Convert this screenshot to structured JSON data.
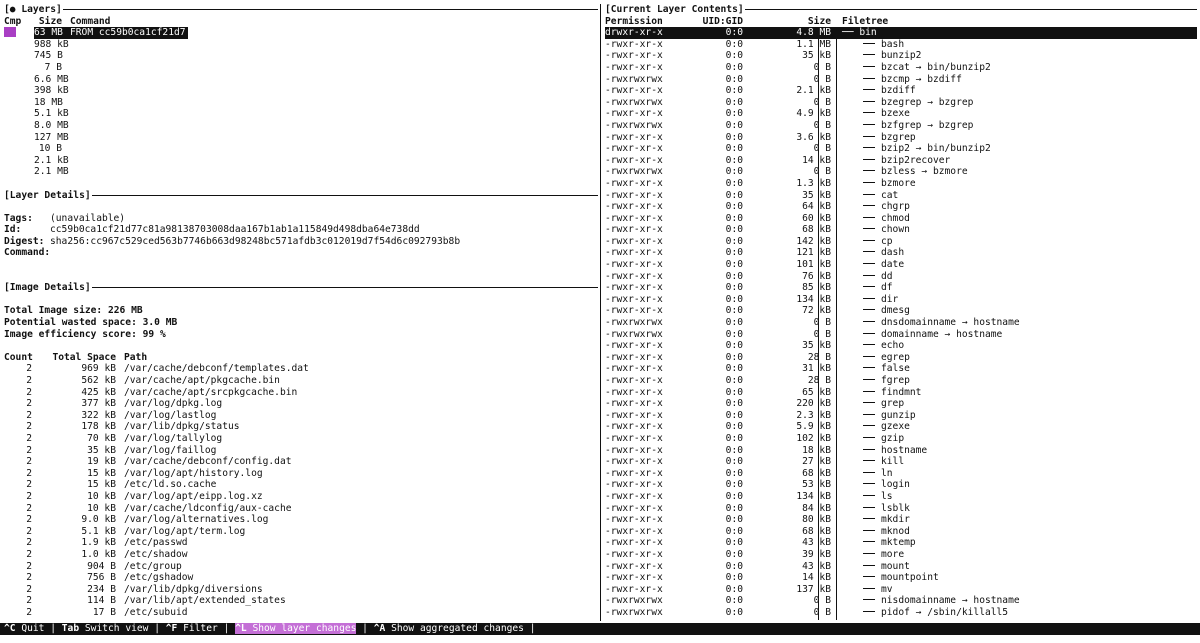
{
  "layers_pane": {
    "title": "[● Layers]",
    "header": {
      "cmp": "Cmp",
      "size": "Size",
      "command": "Command"
    },
    "rows": [
      {
        "size": "63 MB",
        "command": "FROM cc59b0ca1cf21d7",
        "selected": true
      },
      {
        "size": "988 kB",
        "command": ""
      },
      {
        "size": "745 B",
        "command": ""
      },
      {
        "size": "7 B",
        "command": ""
      },
      {
        "size": "6.6 MB",
        "command": ""
      },
      {
        "size": "398 kB",
        "command": ""
      },
      {
        "size": "18 MB",
        "command": ""
      },
      {
        "size": "5.1 kB",
        "command": ""
      },
      {
        "size": "8.0 MB",
        "command": ""
      },
      {
        "size": "127 MB",
        "command": ""
      },
      {
        "size": "10 B",
        "command": ""
      },
      {
        "size": "2.1 kB",
        "command": ""
      },
      {
        "size": "2.1 MB",
        "command": ""
      }
    ]
  },
  "layer_details": {
    "title": "[Layer Details]",
    "tags_label": "Tags:",
    "tags_value": "(unavailable)",
    "id_label": "Id:",
    "id_value": "cc59b0ca1cf21d77c81a98138703008daa167b1ab1a115849d498dba64e738dd",
    "digest_label": "Digest:",
    "digest_value": "sha256:cc967c529ced563b7746b663d98248bc571afdb3c012019d7f54d6c092793b8b",
    "command_label": "Command:"
  },
  "image_details": {
    "title": "[Image Details]",
    "total_size": "Total Image size: 226 MB",
    "wasted": "Potential wasted space: 3.0 MB",
    "efficiency": "Image efficiency score: 99 %",
    "header": {
      "count": "Count",
      "total_space": "Total Space",
      "path": "Path"
    },
    "rows": [
      {
        "count": "2",
        "space": "969 kB",
        "path": "/var/cache/debconf/templates.dat"
      },
      {
        "count": "2",
        "space": "562 kB",
        "path": "/var/cache/apt/pkgcache.bin"
      },
      {
        "count": "2",
        "space": "425 kB",
        "path": "/var/cache/apt/srcpkgcache.bin"
      },
      {
        "count": "2",
        "space": "377 kB",
        "path": "/var/log/dpkg.log"
      },
      {
        "count": "2",
        "space": "322 kB",
        "path": "/var/log/lastlog"
      },
      {
        "count": "2",
        "space": "178 kB",
        "path": "/var/lib/dpkg/status"
      },
      {
        "count": "2",
        "space": "70 kB",
        "path": "/var/log/tallylog"
      },
      {
        "count": "2",
        "space": "35 kB",
        "path": "/var/log/faillog"
      },
      {
        "count": "2",
        "space": "19 kB",
        "path": "/var/cache/debconf/config.dat"
      },
      {
        "count": "2",
        "space": "15 kB",
        "path": "/var/log/apt/history.log"
      },
      {
        "count": "2",
        "space": "15 kB",
        "path": "/etc/ld.so.cache"
      },
      {
        "count": "2",
        "space": "10 kB",
        "path": "/var/log/apt/eipp.log.xz"
      },
      {
        "count": "2",
        "space": "10 kB",
        "path": "/var/cache/ldconfig/aux-cache"
      },
      {
        "count": "2",
        "space": "9.0 kB",
        "path": "/var/log/alternatives.log"
      },
      {
        "count": "2",
        "space": "5.1 kB",
        "path": "/var/log/apt/term.log"
      },
      {
        "count": "2",
        "space": "1.9 kB",
        "path": "/etc/passwd"
      },
      {
        "count": "2",
        "space": "1.0 kB",
        "path": "/etc/shadow"
      },
      {
        "count": "2",
        "space": "904 B",
        "path": "/etc/group"
      },
      {
        "count": "2",
        "space": "756 B",
        "path": "/etc/gshadow"
      },
      {
        "count": "2",
        "space": "234 B",
        "path": "/var/lib/dpkg/diversions"
      },
      {
        "count": "2",
        "space": "114 B",
        "path": "/var/lib/apt/extended_states"
      },
      {
        "count": "2",
        "space": "17 B",
        "path": "/etc/subuid"
      }
    ]
  },
  "contents_pane": {
    "title": "[Current Layer Contents]",
    "header": {
      "permission": "Permission",
      "uidgid": "UID:GID",
      "size": "Size",
      "filetree": "Filetree"
    },
    "root": {
      "perm": "drwxr-xr-x",
      "uidgid": "0:0",
      "size": "4.8 MB",
      "name": "bin"
    },
    "rows": [
      {
        "perm": "-rwxr-xr-x",
        "uidgid": "0:0",
        "size": "1.1 MB",
        "name": "bash"
      },
      {
        "perm": "-rwxr-xr-x",
        "uidgid": "0:0",
        "size": "35 kB",
        "name": "bunzip2"
      },
      {
        "perm": "-rwxr-xr-x",
        "uidgid": "0:0",
        "size": "0 B",
        "name": "bzcat → bin/bunzip2"
      },
      {
        "perm": "-rwxrwxrwx",
        "uidgid": "0:0",
        "size": "0 B",
        "name": "bzcmp → bzdiff"
      },
      {
        "perm": "-rwxr-xr-x",
        "uidgid": "0:0",
        "size": "2.1 kB",
        "name": "bzdiff"
      },
      {
        "perm": "-rwxrwxrwx",
        "uidgid": "0:0",
        "size": "0 B",
        "name": "bzegrep → bzgrep"
      },
      {
        "perm": "-rwxr-xr-x",
        "uidgid": "0:0",
        "size": "4.9 kB",
        "name": "bzexe"
      },
      {
        "perm": "-rwxrwxrwx",
        "uidgid": "0:0",
        "size": "0 B",
        "name": "bzfgrep → bzgrep"
      },
      {
        "perm": "-rwxr-xr-x",
        "uidgid": "0:0",
        "size": "3.6 kB",
        "name": "bzgrep"
      },
      {
        "perm": "-rwxr-xr-x",
        "uidgid": "0:0",
        "size": "0 B",
        "name": "bzip2 → bin/bunzip2"
      },
      {
        "perm": "-rwxr-xr-x",
        "uidgid": "0:0",
        "size": "14 kB",
        "name": "bzip2recover"
      },
      {
        "perm": "-rwxrwxrwx",
        "uidgid": "0:0",
        "size": "0 B",
        "name": "bzless → bzmore"
      },
      {
        "perm": "-rwxr-xr-x",
        "uidgid": "0:0",
        "size": "1.3 kB",
        "name": "bzmore"
      },
      {
        "perm": "-rwxr-xr-x",
        "uidgid": "0:0",
        "size": "35 kB",
        "name": "cat"
      },
      {
        "perm": "-rwxr-xr-x",
        "uidgid": "0:0",
        "size": "64 kB",
        "name": "chgrp"
      },
      {
        "perm": "-rwxr-xr-x",
        "uidgid": "0:0",
        "size": "60 kB",
        "name": "chmod"
      },
      {
        "perm": "-rwxr-xr-x",
        "uidgid": "0:0",
        "size": "68 kB",
        "name": "chown"
      },
      {
        "perm": "-rwxr-xr-x",
        "uidgid": "0:0",
        "size": "142 kB",
        "name": "cp"
      },
      {
        "perm": "-rwxr-xr-x",
        "uidgid": "0:0",
        "size": "121 kB",
        "name": "dash"
      },
      {
        "perm": "-rwxr-xr-x",
        "uidgid": "0:0",
        "size": "101 kB",
        "name": "date"
      },
      {
        "perm": "-rwxr-xr-x",
        "uidgid": "0:0",
        "size": "76 kB",
        "name": "dd"
      },
      {
        "perm": "-rwxr-xr-x",
        "uidgid": "0:0",
        "size": "85 kB",
        "name": "df"
      },
      {
        "perm": "-rwxr-xr-x",
        "uidgid": "0:0",
        "size": "134 kB",
        "name": "dir"
      },
      {
        "perm": "-rwxr-xr-x",
        "uidgid": "0:0",
        "size": "72 kB",
        "name": "dmesg"
      },
      {
        "perm": "-rwxrwxrwx",
        "uidgid": "0:0",
        "size": "0 B",
        "name": "dnsdomainname → hostname"
      },
      {
        "perm": "-rwxrwxrwx",
        "uidgid": "0:0",
        "size": "0 B",
        "name": "domainname → hostname"
      },
      {
        "perm": "-rwxr-xr-x",
        "uidgid": "0:0",
        "size": "35 kB",
        "name": "echo"
      },
      {
        "perm": "-rwxr-xr-x",
        "uidgid": "0:0",
        "size": "28 B",
        "name": "egrep"
      },
      {
        "perm": "-rwxr-xr-x",
        "uidgid": "0:0",
        "size": "31 kB",
        "name": "false"
      },
      {
        "perm": "-rwxr-xr-x",
        "uidgid": "0:0",
        "size": "28 B",
        "name": "fgrep"
      },
      {
        "perm": "-rwxr-xr-x",
        "uidgid": "0:0",
        "size": "65 kB",
        "name": "findmnt"
      },
      {
        "perm": "-rwxr-xr-x",
        "uidgid": "0:0",
        "size": "220 kB",
        "name": "grep"
      },
      {
        "perm": "-rwxr-xr-x",
        "uidgid": "0:0",
        "size": "2.3 kB",
        "name": "gunzip"
      },
      {
        "perm": "-rwxr-xr-x",
        "uidgid": "0:0",
        "size": "5.9 kB",
        "name": "gzexe"
      },
      {
        "perm": "-rwxr-xr-x",
        "uidgid": "0:0",
        "size": "102 kB",
        "name": "gzip"
      },
      {
        "perm": "-rwxr-xr-x",
        "uidgid": "0:0",
        "size": "18 kB",
        "name": "hostname"
      },
      {
        "perm": "-rwxr-xr-x",
        "uidgid": "0:0",
        "size": "27 kB",
        "name": "kill"
      },
      {
        "perm": "-rwxr-xr-x",
        "uidgid": "0:0",
        "size": "68 kB",
        "name": "ln"
      },
      {
        "perm": "-rwxr-xr-x",
        "uidgid": "0:0",
        "size": "53 kB",
        "name": "login"
      },
      {
        "perm": "-rwxr-xr-x",
        "uidgid": "0:0",
        "size": "134 kB",
        "name": "ls"
      },
      {
        "perm": "-rwxr-xr-x",
        "uidgid": "0:0",
        "size": "84 kB",
        "name": "lsblk"
      },
      {
        "perm": "-rwxr-xr-x",
        "uidgid": "0:0",
        "size": "80 kB",
        "name": "mkdir"
      },
      {
        "perm": "-rwxr-xr-x",
        "uidgid": "0:0",
        "size": "68 kB",
        "name": "mknod"
      },
      {
        "perm": "-rwxr-xr-x",
        "uidgid": "0:0",
        "size": "43 kB",
        "name": "mktemp"
      },
      {
        "perm": "-rwxr-xr-x",
        "uidgid": "0:0",
        "size": "39 kB",
        "name": "more"
      },
      {
        "perm": "-rwxr-xr-x",
        "uidgid": "0:0",
        "size": "43 kB",
        "name": "mount"
      },
      {
        "perm": "-rwxr-xr-x",
        "uidgid": "0:0",
        "size": "14 kB",
        "name": "mountpoint"
      },
      {
        "perm": "-rwxr-xr-x",
        "uidgid": "0:0",
        "size": "137 kB",
        "name": "mv"
      },
      {
        "perm": "-rwxrwxrwx",
        "uidgid": "0:0",
        "size": "0 B",
        "name": "nisdomainname → hostname"
      },
      {
        "perm": "-rwxrwxrwx",
        "uidgid": "0:0",
        "size": "0 B",
        "name": "pidof → /sbin/killall5"
      }
    ]
  },
  "footer": {
    "items": [
      {
        "key": "^C",
        "label": "Quit"
      },
      {
        "key": "Tab",
        "label": "Switch view"
      },
      {
        "key": "^F",
        "label": "Filter"
      },
      {
        "key": "^L",
        "label": "Show layer changes",
        "active": true
      },
      {
        "key": "^A",
        "label": "Show aggregated changes"
      }
    ]
  },
  "colors": {
    "cmp_marker": "#a93fc4",
    "active_footer": "#c46fd6",
    "selected_row_bg": "#111111"
  }
}
